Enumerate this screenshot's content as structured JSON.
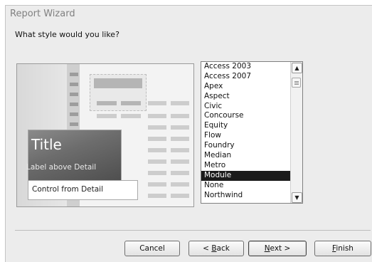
{
  "window": {
    "title": "Report Wizard"
  },
  "prompt": "What style would you like?",
  "preview": {
    "title": "Title",
    "label_text": "Label above Detail",
    "control_text": "Control from Detail"
  },
  "styles_list": {
    "items": [
      "Access 2003",
      "Access 2007",
      "Apex",
      "Aspect",
      "Civic",
      "Concourse",
      "Equity",
      "Flow",
      "Foundry",
      "Median",
      "Metro",
      "Module",
      "None",
      "Northwind"
    ],
    "selected": "Module"
  },
  "buttons": {
    "cancel": "Cancel",
    "back_pre": "< ",
    "back_key": "B",
    "back_post": "ack",
    "next_key": "N",
    "next_post": "ext >",
    "finish_key": "F",
    "finish_post": "inish"
  },
  "icons": {
    "scroll_up": "chevron-up-icon",
    "scroll_down": "chevron-down-icon",
    "scroll_thumb": "scroll-thumb-grip-icon"
  },
  "colors": {
    "dialog_bg": "#ececec",
    "selection_bg": "#1b1b1b"
  }
}
